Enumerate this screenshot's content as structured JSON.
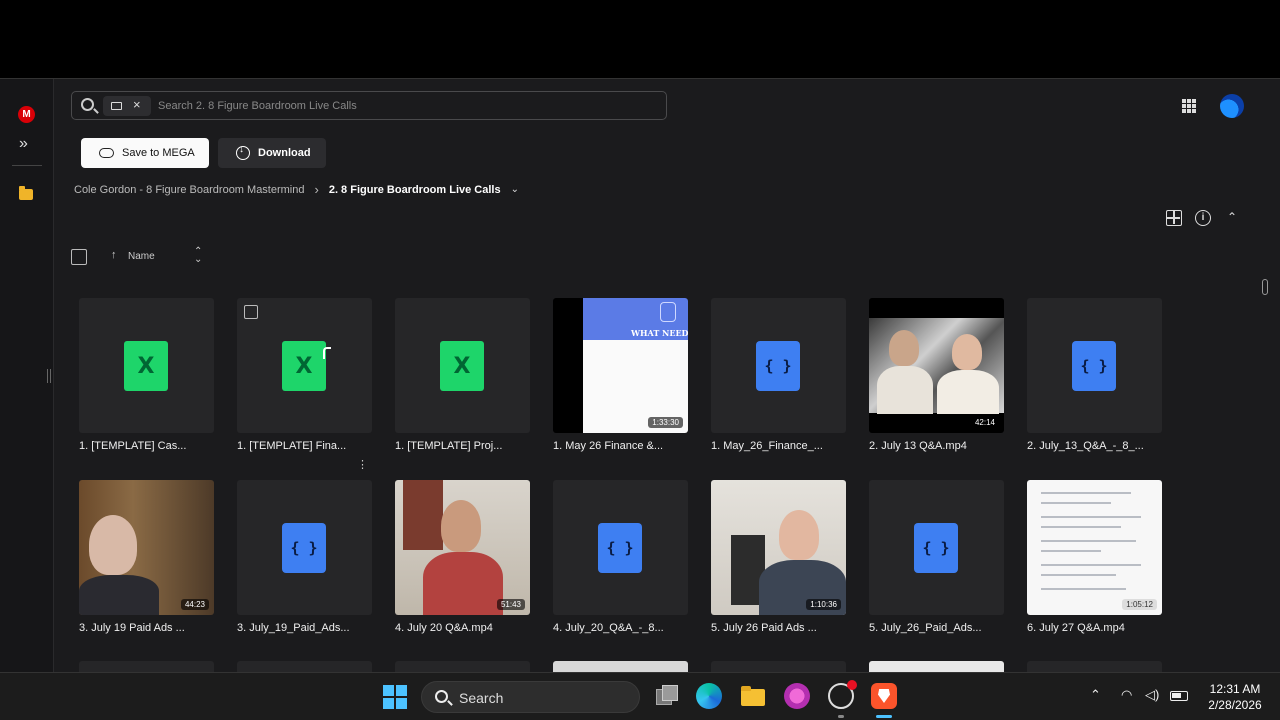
{
  "search": {
    "placeholder": "Search 2. 8 Figure Boardroom Live Calls"
  },
  "actions": {
    "save_label": "Save to MEGA",
    "download_label": "Download"
  },
  "breadcrumb": {
    "parent": "Cole Gordon - 8 Figure Boardroom Mastermind",
    "current": "2. 8 Figure Boardroom Live Calls"
  },
  "sort": {
    "label": "Name"
  },
  "files": [
    {
      "name": "1. [TEMPLATE] Cas...",
      "type": "spreadsheet",
      "icon": "xls-icon"
    },
    {
      "name": "1. [TEMPLATE] Fina...",
      "type": "spreadsheet",
      "icon": "xls-icon"
    },
    {
      "name": "1. [TEMPLATE] Proj...",
      "type": "spreadsheet",
      "icon": "xls-icon"
    },
    {
      "name": "1. May 26 Finance &...",
      "type": "video",
      "duration": "1:33:30",
      "thumb_text": "WHAT NEED"
    },
    {
      "name": "1. May_26_Finance_...",
      "type": "code",
      "icon": "code-icon"
    },
    {
      "name": "2. July 13 Q&A.mp4",
      "type": "video",
      "duration": "42:14"
    },
    {
      "name": "2. July_13_Q&A_-_8_...",
      "type": "code",
      "icon": "code-icon"
    },
    {
      "name": "3. July 19 Paid Ads ...",
      "type": "video",
      "duration": "44:23"
    },
    {
      "name": "3. July_19_Paid_Ads...",
      "type": "code",
      "icon": "code-icon"
    },
    {
      "name": "4. July 20 Q&A.mp4",
      "type": "video",
      "duration": "51:43"
    },
    {
      "name": "4. July_20_Q&A_-_8...",
      "type": "code",
      "icon": "code-icon"
    },
    {
      "name": "5. July 26 Paid Ads ...",
      "type": "video",
      "duration": "1:10:36"
    },
    {
      "name": "5. July_26_Paid_Ads...",
      "type": "code",
      "icon": "code-icon"
    },
    {
      "name": "6. July 27 Q&A.mp4",
      "type": "video",
      "duration": "1:05:12"
    }
  ],
  "xls_glyph": "X",
  "code_glyph": "{ }",
  "taskbar": {
    "search_label": "Search",
    "time": "12:31 AM",
    "date": "2/28/2026"
  },
  "colors": {
    "background": "#1b1b1d",
    "tile": "#262628",
    "spreadsheet": "#1ed56a",
    "code": "#3e7ff2",
    "mega_red": "#d90007"
  }
}
